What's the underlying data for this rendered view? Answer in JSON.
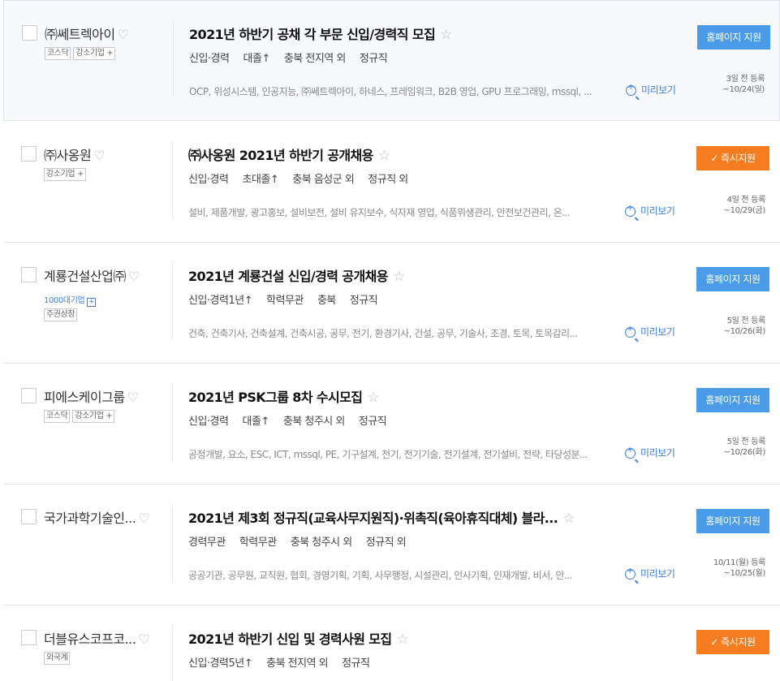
{
  "rows": [
    {
      "company": "㈜쎄트렉아이",
      "tags": [
        "코스닥",
        "강소기업 +"
      ],
      "title": "2021년 하반기 공채 각 부문 신입/경력직 모집",
      "conditions": [
        "신입·경력",
        "대졸↑",
        "충북 전지역 외",
        "정규직"
      ],
      "sectors": "OCP, 위성시스템, 인공지능, ㈜쎄트렉아이, 하네스, 프레임워크, B2B 영업, GPU 프로그래밍, mssql, ...",
      "preview": "미리보기",
      "button": "홈페이지 지원",
      "button_type": "home",
      "date_line1": "3일 전 등록",
      "date_line2": "~10/24(일)"
    },
    {
      "company": "㈜사옹원",
      "tags": [
        "강소기업 +"
      ],
      "title": "㈜사옹원 2021년 하반기 공개채용",
      "conditions": [
        "신입·경력",
        "초대졸↑",
        "충북 음성군 외",
        "정규직 외"
      ],
      "sectors": "설비, 제품개발, 광고홍보, 설비보전, 설비 유지보수, 식자재 영업, 식품위생관리, 안전보건관리, 온...",
      "preview": "미리보기",
      "button": "즉시지원",
      "button_type": "instant",
      "date_line1": "4일 전 등록",
      "date_line2": "~10/29(금)"
    },
    {
      "company": "계룡건설산업㈜",
      "tags": [
        "주권상장"
      ],
      "big_label": "1000대기업",
      "title": "2021년 계룡건설 신입/경력 공개채용",
      "conditions": [
        "신입·경력1년↑",
        "학력무관",
        "충북",
        "정규직"
      ],
      "sectors": "건축, 건축기사, 건축설계, 건축시공, 공무, 전기, 환경기사, 건설, 공무, 기술사, 조경, 토목, 토목감리...",
      "preview": "미리보기",
      "button": "홈페이지 지원",
      "button_type": "home",
      "date_line1": "5일 전 등록",
      "date_line2": "~10/26(화)"
    },
    {
      "company": "피에스케이그룹",
      "tags": [
        "코스닥",
        "강소기업 +"
      ],
      "title": "2021년 PSK그룹 8차 수시모집",
      "conditions": [
        "신입·경력",
        "대졸↑",
        "충북 청주시 외",
        "정규직"
      ],
      "sectors": "공정개발, 요소, ESC, ICT, mssql, PE, 기구설계, 전기, 전기기술, 전기설계, 전기설비, 전략, 타당성분...",
      "preview": "미리보기",
      "button": "홈페이지 지원",
      "button_type": "home",
      "date_line1": "5일 전 등록",
      "date_line2": "~10/26(화)"
    },
    {
      "company": "국가과학기술인...",
      "tags": [],
      "title": "2021년 제3회 정규직(교육사무지원직)·위촉직(육아휴직대체) 블라...",
      "conditions": [
        "경력무관",
        "학력무관",
        "충북 청주시 외",
        "정규직 외"
      ],
      "sectors": "공공기관, 공무원, 교직원, 협회, 경영기획, 기획, 사무행정, 시설관리, 인사기획, 인재개발, 비서, 안...",
      "preview": "미리보기",
      "button": "홈페이지 지원",
      "button_type": "home",
      "date_line1": "10/11(월) 등록",
      "date_line2": "~10/25(월)"
    },
    {
      "company": "더블유스코프코...",
      "tags": [
        "외국계"
      ],
      "title": "2021년 하반기 신입 및 경력사원 모집",
      "conditions": [
        "신입·경력5년↑",
        "충북 전지역 외",
        "정규직"
      ],
      "sectors": "",
      "preview": "",
      "button": "즉시지원",
      "button_type": "instant",
      "date_line1": "",
      "date_line2": ""
    }
  ],
  "icons": {
    "heart": "heart-icon",
    "star": "star-icon",
    "preview": "zoom-plus-icon",
    "check": "check-icon"
  },
  "colors": {
    "home_button": "#4a9be8",
    "instant_button": "#f57d1f",
    "link": "#3d7fe0"
  },
  "symbols": {
    "heart": "♡",
    "star": "☆",
    "check": "✓",
    "plus": "+"
  }
}
